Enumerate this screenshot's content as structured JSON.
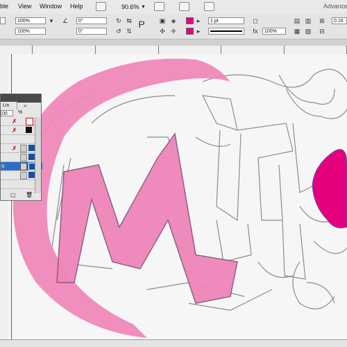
{
  "menu": {
    "items": [
      "ble",
      "View",
      "Window",
      "Help"
    ],
    "zoom": "90.6%",
    "workspace": "Advance"
  },
  "control": {
    "scale_x": "100%",
    "scale_y": "100%",
    "rotate": "0°",
    "shear": "0°",
    "stroke_weight": "1 pt",
    "opacity": "100%",
    "ref_value": "0.16"
  },
  "panel": {
    "tab": "Lin",
    "collapse": "«",
    "value": "00",
    "unit": "%",
    "selected_row": "o"
  },
  "colors": {
    "fill": "#e6007e",
    "shape_pink": "#ef85b9",
    "guide": "#c21fa9",
    "selection": "#2f6fc2"
  }
}
